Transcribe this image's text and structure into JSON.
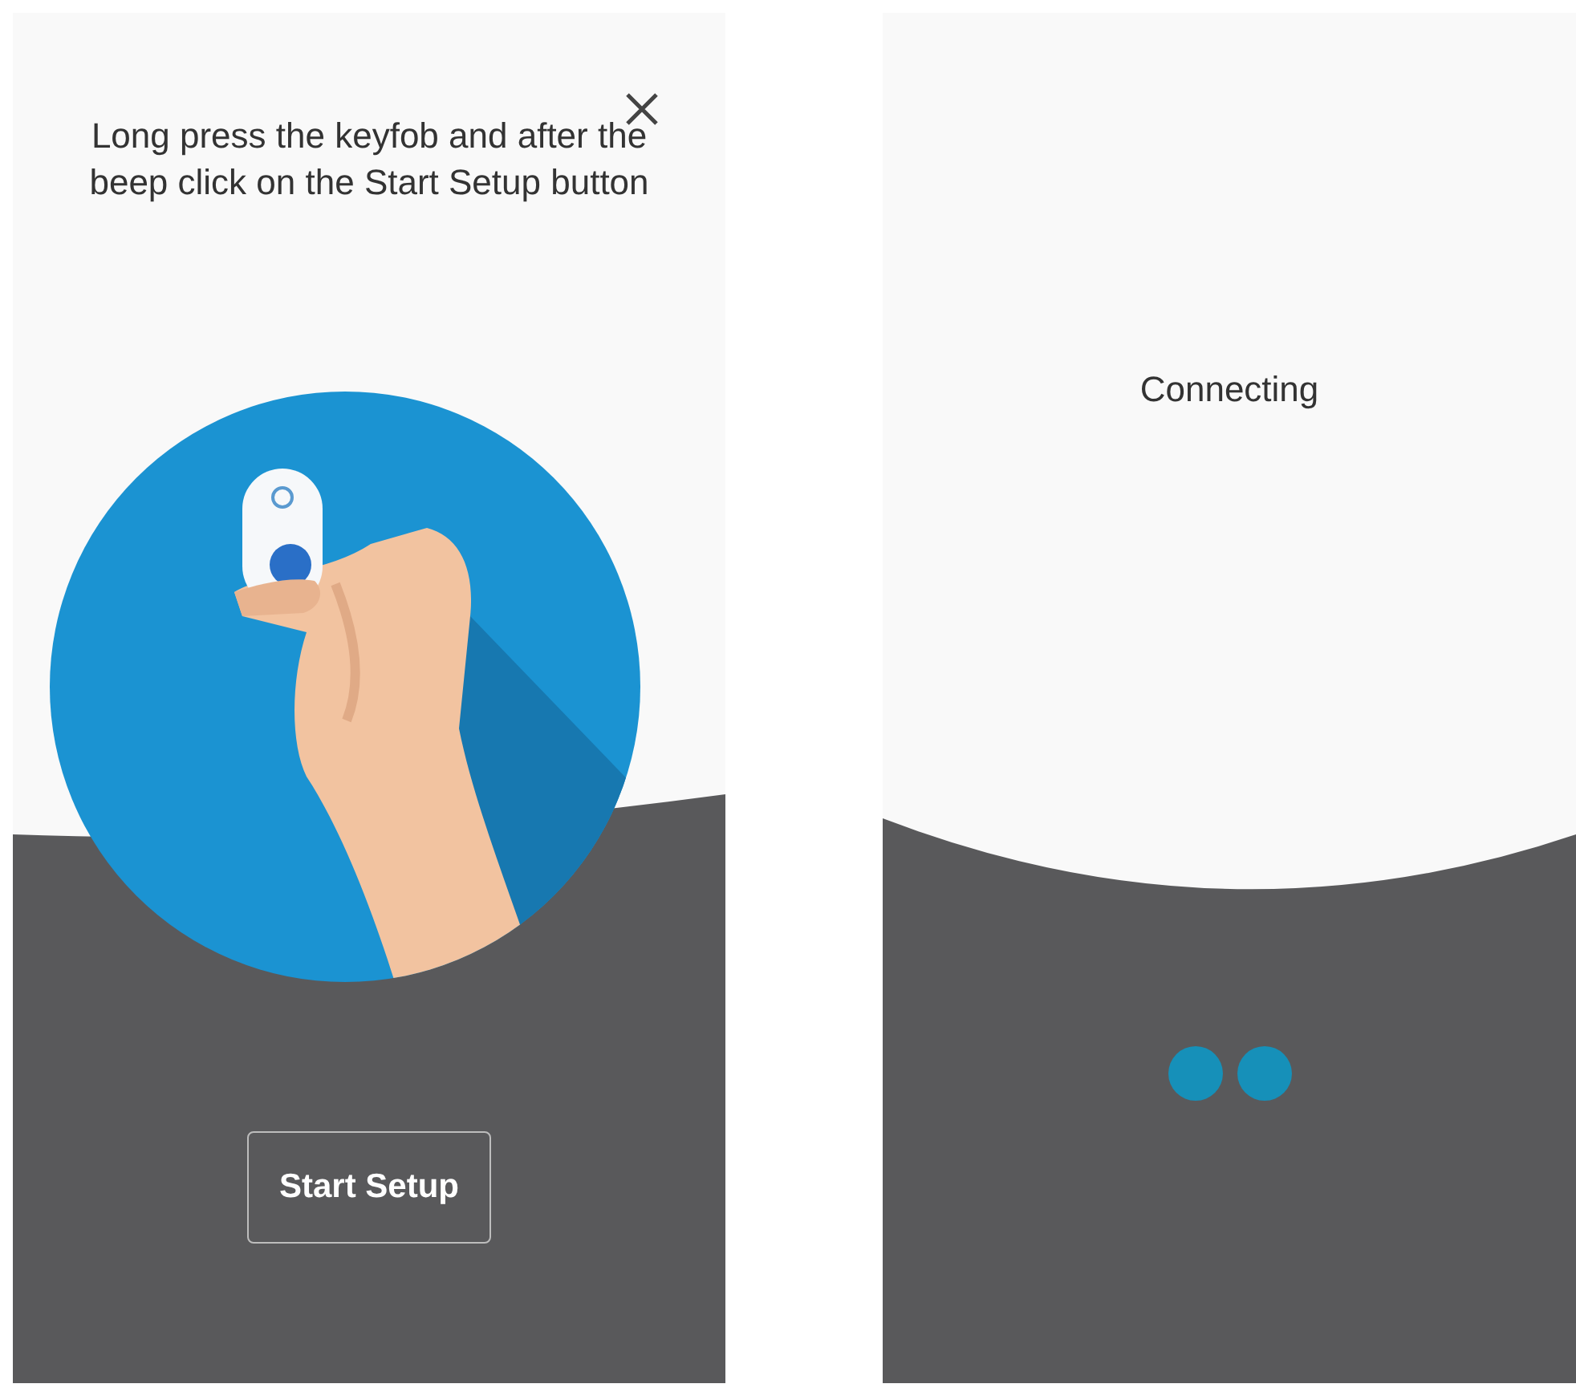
{
  "setup_screen": {
    "instruction": "Long press the keyfob and after the beep click on the Start Setup button",
    "button": "Start Setup"
  },
  "connecting_screen": {
    "status": "Connecting"
  }
}
